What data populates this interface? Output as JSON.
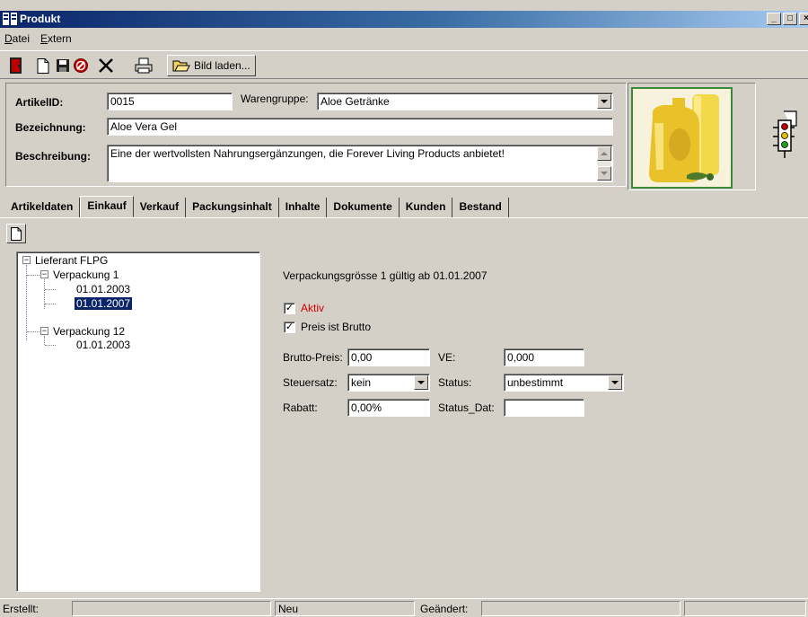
{
  "window": {
    "title": "Produkt",
    "controls": [
      "_",
      "□",
      "×"
    ]
  },
  "menu": [
    {
      "label": "Datei",
      "accel": "D",
      "rest": "atei"
    },
    {
      "label": "Extern",
      "accel": "E",
      "rest": "xtern"
    }
  ],
  "toolbar": {
    "bild_laden_label": "Bild laden..."
  },
  "header": {
    "artikelid_label": "ArtikelID:",
    "artikelid_value": "0015",
    "warengruppe_label": "Warengruppe:",
    "warengruppe_value": "Aloe Getränke",
    "bezeichnung_label": "Bezeichnung:",
    "bezeichnung_value": "Aloe Vera Gel",
    "beschreibung_label": "Beschreibung:",
    "beschreibung_value": "Eine der wertvollsten Nahrungsergänzungen, die Forever Living Products anbietet!"
  },
  "tabs": [
    {
      "label": "Artikeldaten",
      "active": false
    },
    {
      "label": "Einkauf",
      "active": true
    },
    {
      "label": "Verkauf",
      "active": false
    },
    {
      "label": "Packungsinhalt",
      "active": false
    },
    {
      "label": "Inhalte",
      "active": false
    },
    {
      "label": "Dokumente",
      "active": false
    },
    {
      "label": "Kunden",
      "active": false
    },
    {
      "label": "Bestand",
      "active": false
    }
  ],
  "tree": {
    "root": "Lieferant FLPG",
    "pkg1": "Verpackung 1",
    "pkg1_d1": "01.01.2003",
    "pkg1_d2": "01.01.2007",
    "pkg2": "Verpackung 12",
    "pkg2_d1": "01.01.2003"
  },
  "detail": {
    "heading": "Verpackungsgrösse 1 gültig ab 01.01.2007",
    "aktiv_label": "Aktiv",
    "aktiv_checked": true,
    "brutto_label": "Preis ist Brutto",
    "brutto_checked": true,
    "bruttopreis_label": "Brutto-Preis:",
    "bruttopreis_value": "0,00",
    "ve_label": "VE:",
    "ve_value": "0,000",
    "steuersatz_label": "Steuersatz:",
    "steuersatz_value": "kein",
    "status_label": "Status:",
    "status_value": "unbestimmt",
    "rabatt_label": "Rabatt:",
    "rabatt_value": "0,00%",
    "statusdat_label": "Status_Dat:",
    "statusdat_value": ""
  },
  "statusbar": {
    "erstellt_label": "Erstellt:",
    "erstellt_value": "",
    "neu_label": "Neu",
    "geaendert_label": "Geändert:",
    "geaendert_value": ""
  },
  "colors": {
    "titlebar": "#0a246a",
    "selection": "#0a246a",
    "aktiv": "#cc0000",
    "photo_border": "#3a8a3a"
  }
}
